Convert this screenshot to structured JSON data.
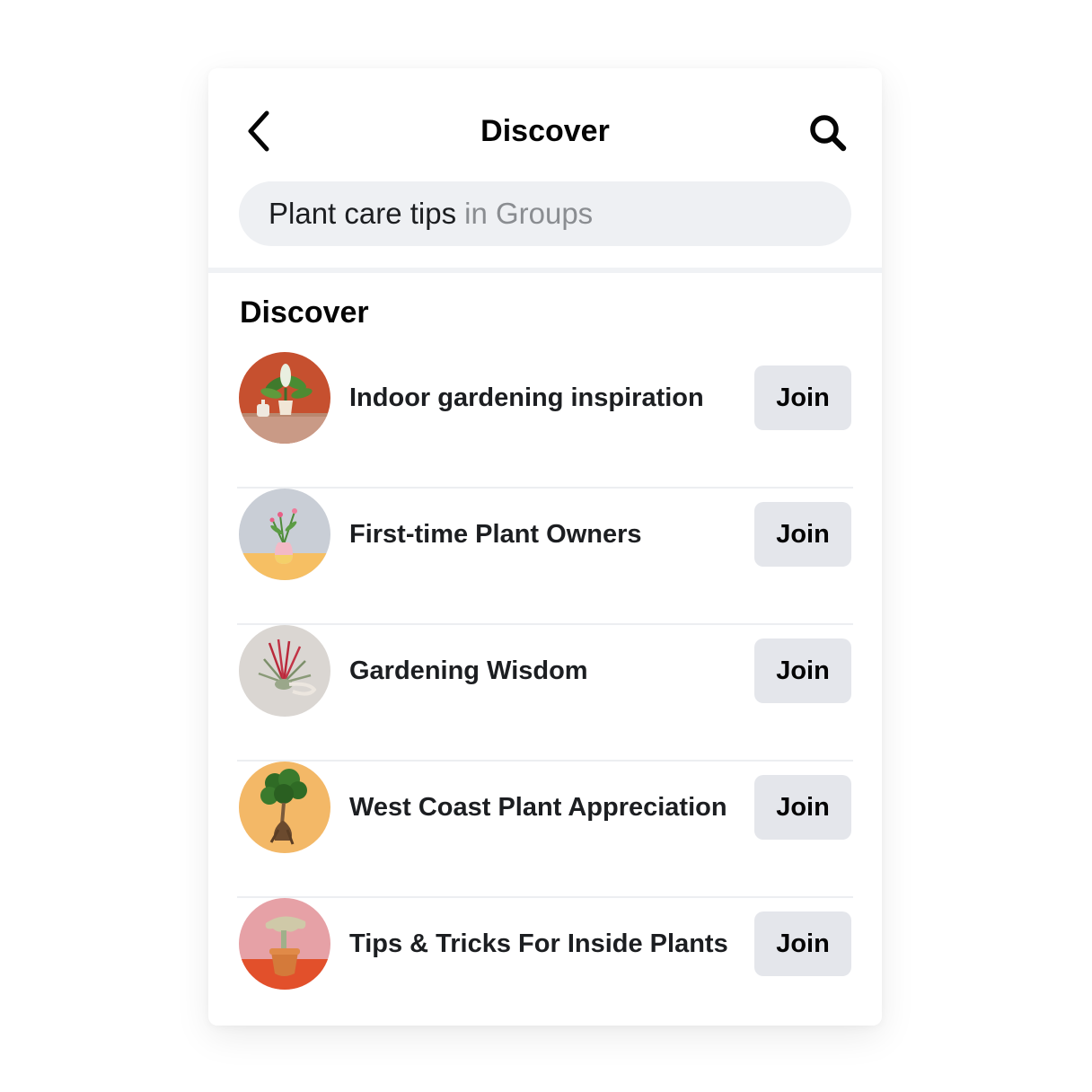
{
  "header": {
    "title": "Discover",
    "back_icon": "chevron-left-icon",
    "search_icon": "search-icon"
  },
  "search": {
    "query": "Plant care tips",
    "scope": "in Groups"
  },
  "section": {
    "title": "Discover"
  },
  "groups": [
    {
      "name": "Indoor gardening inspiration",
      "button": "Join"
    },
    {
      "name": "First-time Plant Owners",
      "button": "Join"
    },
    {
      "name": "Gardening Wisdom",
      "button": "Join"
    },
    {
      "name": "West Coast Plant Appreciation",
      "button": "Join"
    },
    {
      "name": "Tips & Tricks For Inside Plants",
      "button": "Join"
    }
  ],
  "colors": {
    "button_bg": "#e4e6eb",
    "search_bg": "#eef0f3",
    "scope_text": "#8a8d91"
  }
}
